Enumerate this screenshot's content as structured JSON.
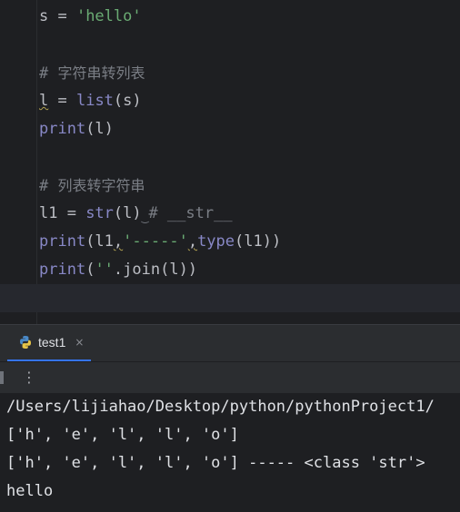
{
  "code": {
    "l1": {
      "var": "s = ",
      "str": "'hello'"
    },
    "l2": {
      "hash": "# ",
      "text": "字符串转列表"
    },
    "l3": {
      "var": "l",
      "eq": " = ",
      "fn": "list",
      "args": "(s)"
    },
    "l4": {
      "fn": "print",
      "args": "(l)"
    },
    "l5": {
      "hash": "# ",
      "text": "列表转字符串"
    },
    "l6": {
      "var": "l1 = ",
      "fn": "str",
      "args": "(l)",
      "comment": "# __str__"
    },
    "l7": {
      "fn": "print",
      "open": "(l1",
      "comma1": ",",
      "str": "'-----'",
      "comma2": ",",
      "fn2": "type",
      "rest": "(l1))"
    },
    "l8": {
      "fn": "print",
      "open": "(",
      "str": "''",
      "rest": ".join(l))"
    }
  },
  "run_panel": {
    "tab_label": "test1",
    "close_glyph": "×",
    "more_glyph": "⋮"
  },
  "console": {
    "lines": [
      "/Users/lijiahao/Desktop/python/pythonProject1/",
      "['h', 'e', 'l', 'l', 'o']",
      "['h', 'e', 'l', 'l', 'o'] ----- <class 'str'>",
      "hello"
    ]
  },
  "colors": {
    "background": "#1e1f22",
    "string": "#6aab73",
    "builtin": "#8888c6",
    "comment": "#7a7e85",
    "accent": "#3574f0"
  }
}
